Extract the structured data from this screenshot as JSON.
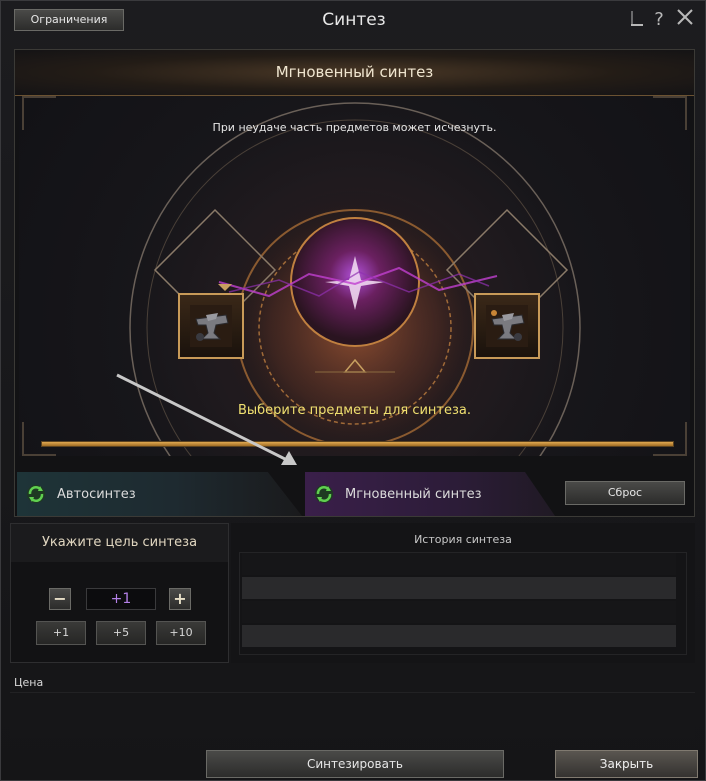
{
  "window": {
    "title": "Синтез",
    "limits_label": "Ограничения",
    "help_icon": "question-icon",
    "minimize_icon": "minimize-icon",
    "close_icon": "close-icon"
  },
  "synthesis_panel": {
    "header": "Мгновенный синтез",
    "warning": "При неудаче часть предметов может исчезнуть.",
    "prompt": "Выберите предметы для синтеза.",
    "progress_fraction": 1.0,
    "left_slot_icon": "anvil-icon",
    "right_slot_icon": "anvil-icon",
    "colors": {
      "accent_gold": "#c89a58",
      "prompt_yellow": "#f0e070",
      "magic_purple": "#b040d0"
    }
  },
  "tabs": {
    "auto": {
      "label": "Автосинтез",
      "icon": "refresh-icon"
    },
    "instant": {
      "label": "Мгновенный синтез",
      "icon": "refresh-icon",
      "active": true
    },
    "reset_label": "Сброс"
  },
  "target": {
    "title": "Укажите цель синтеза",
    "minus_label": "−",
    "plus_label": "+",
    "value": "+1",
    "increments": [
      "+1",
      "+5",
      "+10"
    ]
  },
  "history": {
    "title": "История синтеза",
    "rows": [
      "",
      "",
      "",
      ""
    ]
  },
  "price": {
    "label": "Цена"
  },
  "actions": {
    "synthesize_label": "Синтезировать",
    "close_label": "Закрыть"
  }
}
